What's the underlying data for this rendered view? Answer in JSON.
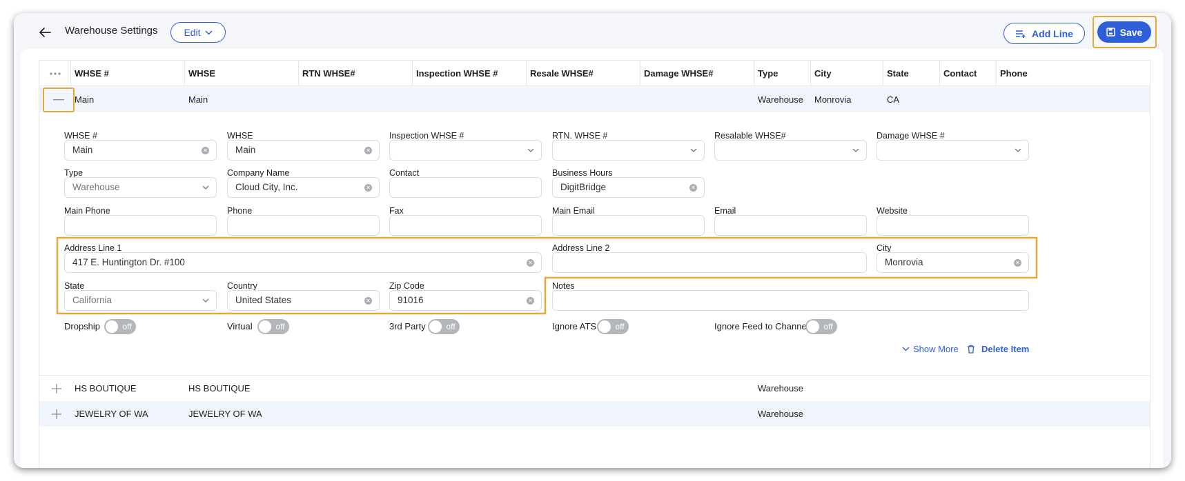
{
  "header": {
    "title": "Warehouse Settings",
    "edit_label": "Edit",
    "add_line_label": "Add Line",
    "save_label": "Save"
  },
  "grid": {
    "columns": [
      "WHSE #",
      "WHSE",
      "RTN WHSE#",
      "Inspection WHSE #",
      "Resale WHSE#",
      "Damage WHSE#",
      "Type",
      "City",
      "State",
      "Contact",
      "Phone"
    ],
    "rows": [
      {
        "whse_no": "Main",
        "whse": "Main",
        "type": "Warehouse",
        "city": "Monrovia",
        "state": "CA"
      },
      {
        "whse_no": "HS BOUTIQUE",
        "whse": "HS BOUTIQUE",
        "type": "Warehouse"
      },
      {
        "whse_no": "JEWELRY OF WA",
        "whse": "JEWELRY OF WA",
        "type": "Warehouse"
      }
    ]
  },
  "detail": {
    "labels": {
      "whse_no": "WHSE #",
      "whse": "WHSE",
      "inspection": "Inspection WHSE #",
      "rtn": "RTN. WHSE #",
      "resalable": "Resalable WHSE#",
      "damage": "Damage WHSE #",
      "type": "Type",
      "company": "Company Name",
      "contact": "Contact",
      "business_hours": "Business Hours",
      "main_phone": "Main Phone",
      "phone": "Phone",
      "fax": "Fax",
      "main_email": "Main Email",
      "email": "Email",
      "website": "Website",
      "address1": "Address Line 1",
      "address2": "Address Line 2",
      "city": "City",
      "state": "State",
      "country": "Country",
      "zip": "Zip Code",
      "notes": "Notes"
    },
    "values": {
      "whse_no": "Main",
      "whse": "Main",
      "type": "Warehouse",
      "company": "Cloud City, Inc.",
      "business_hours": "DigitBridge",
      "address1": "417 E. Huntington Dr. #100",
      "city": "Monrovia",
      "state": "California",
      "country": "United States",
      "zip": "91016"
    },
    "switches": {
      "dropship": "Dropship",
      "virtual": "Virtual",
      "third_party": "3rd Party",
      "ignore_ats": "Ignore ATS",
      "ignore_feed": "Ignore Feed to Channel",
      "off_text": "off"
    },
    "show_more": "Show More",
    "delete_item": "Delete Item"
  },
  "colors": {
    "accent": "#2f5fd6",
    "highlight": "#e5a93b",
    "row_bg": "#f0f4fb"
  }
}
